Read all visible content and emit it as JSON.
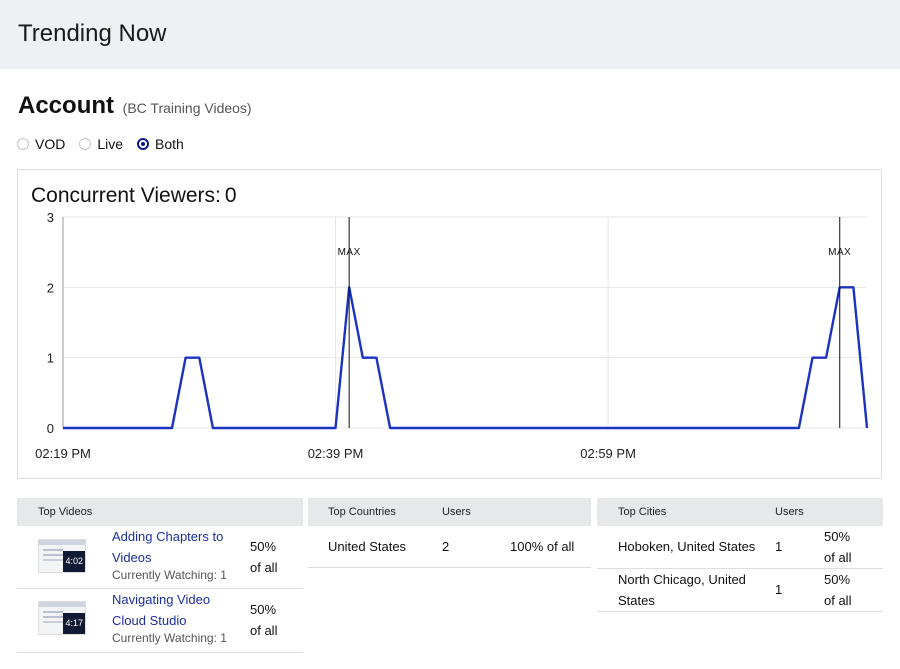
{
  "header": {
    "title": "Trending Now"
  },
  "account": {
    "label": "Account",
    "name": "(BC Training Videos)"
  },
  "filters": {
    "options": [
      "VOD",
      "Live",
      "Both"
    ],
    "selected": "Both"
  },
  "accent_color": "#0a1a8a",
  "line_color": "#1a33c0",
  "concurrent": {
    "label": "Concurrent Viewers:",
    "value": "0"
  },
  "chart_data": {
    "type": "line",
    "title": "Concurrent Viewers: 0",
    "xlabel": "",
    "ylabel": "",
    "ylim": [
      0,
      3
    ],
    "xlim_minutes": [
      0,
      59
    ],
    "y_ticks": [
      "0",
      "1",
      "2",
      "3"
    ],
    "x_ticks": [
      {
        "label": "02:19 PM",
        "minute": 0
      },
      {
        "label": "02:39 PM",
        "minute": 20
      },
      {
        "label": "02:59 PM",
        "minute": 40
      }
    ],
    "grid": true,
    "markers": [
      {
        "label": "MAX",
        "minute": 21
      },
      {
        "label": "MAX",
        "minute": 57
      }
    ],
    "series": [
      {
        "x": [
          0,
          1,
          2,
          3,
          4,
          5,
          6,
          7,
          8,
          9,
          10,
          11,
          12,
          13,
          14,
          15,
          16,
          17,
          18,
          19,
          20,
          21,
          22,
          23,
          24,
          25,
          26,
          27,
          28,
          29,
          30,
          31,
          32,
          33,
          34,
          35,
          36,
          37,
          38,
          39,
          40,
          41,
          42,
          43,
          44,
          45,
          46,
          47,
          48,
          49,
          50,
          51,
          52,
          53,
          54,
          55,
          56,
          57,
          58,
          59
        ],
        "values": [
          0,
          0,
          0,
          0,
          0,
          0,
          0,
          0,
          0,
          1,
          1,
          0,
          0,
          0,
          0,
          0,
          0,
          0,
          0,
          0,
          0,
          2,
          1,
          1,
          0,
          0,
          0,
          0,
          0,
          0,
          0,
          0,
          0,
          0,
          0,
          0,
          0,
          0,
          0,
          0,
          0,
          0,
          0,
          0,
          0,
          0,
          0,
          0,
          0,
          0,
          0,
          0,
          0,
          0,
          0,
          1,
          1,
          2,
          2,
          0
        ]
      }
    ]
  },
  "top_videos": {
    "header": "Top Videos",
    "rows": [
      {
        "title_line1": "Adding Chapters to",
        "title_line2": "Videos",
        "watching": "Currently Watching: 1",
        "duration": "4:02",
        "pct_line1": "50%",
        "pct_line2": "of all"
      },
      {
        "title_line1": "Navigating Video",
        "title_line2": "Cloud Studio",
        "watching": "Currently Watching: 1",
        "duration": "4:17",
        "pct_line1": "50%",
        "pct_line2": "of all"
      }
    ]
  },
  "top_countries": {
    "header": "Top Countries",
    "users_header": "Users",
    "rows": [
      {
        "name": "United States",
        "users": "2",
        "pct": "100% of all"
      }
    ]
  },
  "top_cities": {
    "header": "Top Cities",
    "users_header": "Users",
    "rows": [
      {
        "name_line1": "Hoboken, United States",
        "name_line2": "",
        "users": "1",
        "pct_line1": "50%",
        "pct_line2": "of all"
      },
      {
        "name_line1": "North Chicago, United",
        "name_line2": "States",
        "users": "1",
        "pct_line1": "50%",
        "pct_line2": "of all"
      }
    ]
  }
}
